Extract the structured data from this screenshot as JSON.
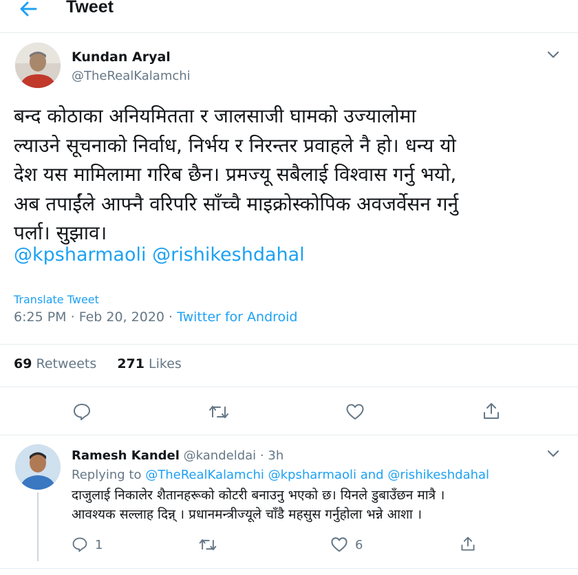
{
  "header": {
    "title": "Tweet",
    "back_icon": "arrow-left-icon"
  },
  "tweet": {
    "author_name": "Kundan Aryal",
    "author_handle": "@TheRealKalamchi",
    "text_lines": [
      "बन्द कोठाका अनियमितता र जालसाजी घामको उज्यालोमा",
      "ल्याउने सूचनाको निर्वाध, निर्भय र निरन्तर प्रवाहले नै हो। धन्य यो",
      "देश यस मामिलामा गरिब छैन। प्रमज्यू सबैलाई विश्वास गर्नु भयो,",
      "अब तपाईंले आफ्नै वरिपरि साँच्चै माइक्रोस्कोपिक अवजर्वेसन गर्नु",
      "पर्ला। सुझाव।"
    ],
    "mentions": [
      "@kpsharmaoli",
      "@rishikeshdahal"
    ],
    "translate_label": "Translate Tweet",
    "time": "6:25 PM",
    "date": "Feb 20, 2020",
    "separator": "·",
    "source": "Twitter for Android",
    "retweets_count": "69",
    "retweets_label": "Retweets",
    "likes_count": "271",
    "likes_label": "Likes"
  },
  "reply": {
    "author_name": "Ramesh Kandel",
    "author_handle": "@kandeldai",
    "separator": "·",
    "time": "3h",
    "replying_prefix": "Replying to",
    "replying_handles": [
      "@TheRealKalamchi",
      "@kpsharmaoli",
      "@rishikeshdahal"
    ],
    "replying_and": "and",
    "text_lines": [
      "दाजुलाई निकालेर शैतानहरूको कोटरी बनाउनु भएको छ। यिनले डुबाउँछन मात्रै ।",
      "आवश्यक सल्लाह दिन्न् । प्रधानमन्त्रीज्यूले चाँडै महसुस गर्नुहोला भन्ने आशा ।"
    ],
    "reply_count": "1",
    "like_count": "6"
  },
  "colors": {
    "accent": "#1da1f2",
    "muted": "#657786",
    "text": "#14171a",
    "divider": "#e6ecf0"
  }
}
